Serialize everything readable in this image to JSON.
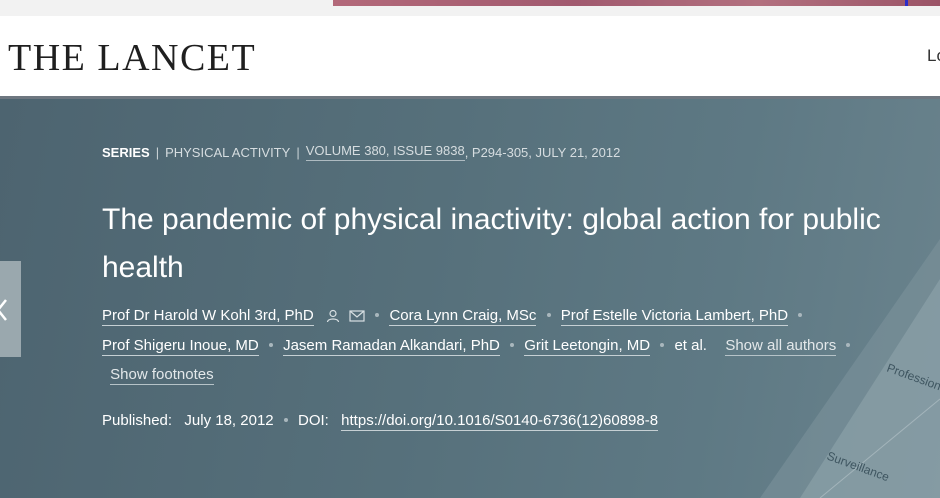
{
  "header": {
    "logo": "THE LANCET",
    "login_partial": "Lo"
  },
  "breadcrumb": {
    "type": "SERIES",
    "section": "PHYSICAL ACTIVITY",
    "volume_issue": "VOLUME 380, ISSUE 9838",
    "pages_date": ", P294-305, JULY 21, 2012"
  },
  "article": {
    "title": "The pandemic of physical inactivity: global action for public health"
  },
  "authors": {
    "row1": [
      "Prof Dr Harold W Kohl 3rd, PhD",
      "Cora Lynn Craig, MSc",
      "Prof Estelle Victoria Lambert, PhD"
    ],
    "row2": [
      "Prof Shigeru Inoue, MD",
      "Jasem Ramadan Alkandari, PhD",
      "Grit Leetongin, MD"
    ],
    "et_al": "et al.",
    "show_all": "Show all authors",
    "show_footnotes": "Show footnotes"
  },
  "publication": {
    "published_label": "Published:",
    "published_date": "July 18, 2012",
    "doi_label": "DOI:",
    "doi_link": "https://doi.org/10.1016/S0140-6736(12)60898-8"
  },
  "cover_graphic": {
    "label_1": "Professional",
    "label_2": "Surveillance"
  },
  "colors": {
    "hero_bg": "#56707b",
    "header_rule": "#6e7780"
  }
}
